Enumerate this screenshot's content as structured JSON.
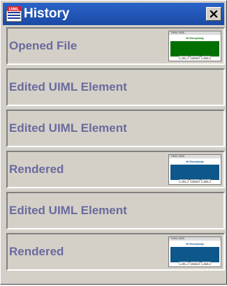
{
  "window": {
    "title": "History",
    "icon": "uiml-app-icon",
    "close_label": "close"
  },
  "colors": {
    "titlebar": "#1e52b4",
    "window_bg": "#d4d0c8",
    "item_text": "#6a6a9e",
    "thumb_green": "#007000",
    "thumb_blue": "#0d578a"
  },
  "history": {
    "items": [
      {
        "label": "Opened File",
        "has_preview": true,
        "preview_variant": "green"
      },
      {
        "label": "Edited UIML Element",
        "has_preview": false
      },
      {
        "label": "Edited UIML Element",
        "has_preview": false
      },
      {
        "label": "Rendered",
        "has_preview": true,
        "preview_variant": "blue"
      },
      {
        "label": "Edited UIML Element",
        "has_preview": false
      },
      {
        "label": "Rendered",
        "has_preview": true,
        "preview_variant": "blue"
      }
    ]
  },
  "preview": {
    "window_title": "Hello UIML",
    "heading": "Hi Everybody",
    "buttons": [
      "OK",
      "Cancel",
      "Help"
    ]
  }
}
